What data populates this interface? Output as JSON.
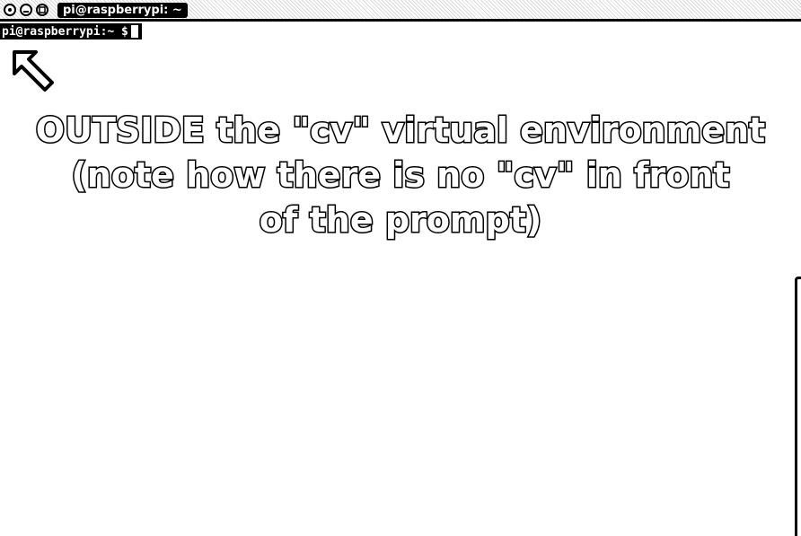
{
  "window": {
    "title": "pi@raspberrypi: ~"
  },
  "terminal": {
    "prompt": "pi@raspberrypi:~ $"
  },
  "annotation": {
    "lines": [
      "OUTSIDE the \"cv\" virtual environment",
      "(note how there is no \"cv\" in front",
      "of the prompt)"
    ]
  },
  "icons": {
    "titlebar": [
      "window-menu-icon",
      "minimize-icon",
      "maximize-icon"
    ],
    "annotation": "arrow-up-left-icon"
  }
}
